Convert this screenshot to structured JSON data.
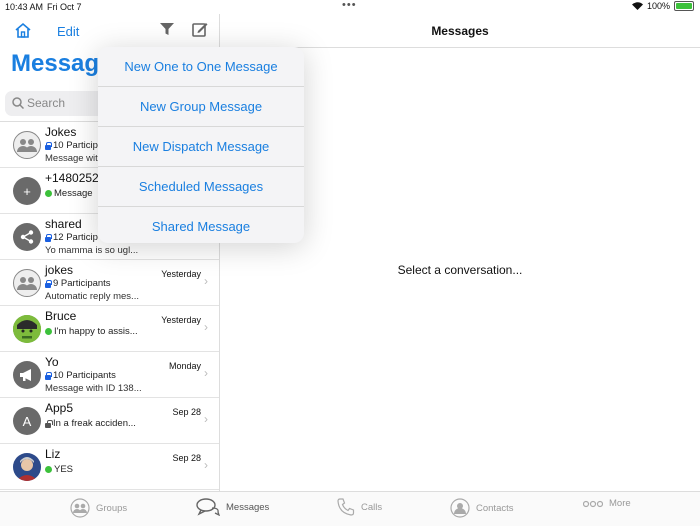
{
  "status": {
    "time": "10:43 AM",
    "date": "Fri Oct 7",
    "battery": "100%"
  },
  "sidebar": {
    "edit_label": "Edit",
    "title": "Messages",
    "search_placeholder": "Search",
    "conversations": [
      {
        "name": "Jokes",
        "sub": "10 Particip",
        "msg": "Message wit",
        "date": "",
        "avatar": "group",
        "badge": "lock"
      },
      {
        "name": "+1480252",
        "sub": "Message",
        "msg": "",
        "date": "",
        "avatar": "plus",
        "badge": "wa"
      },
      {
        "name": "shared",
        "sub": "12 Particip",
        "msg": "Yo mamma is so ugl...",
        "date": "",
        "avatar": "share",
        "badge": "lock"
      },
      {
        "name": "jokes",
        "sub": "9 Participants",
        "msg": "Automatic reply mes...",
        "date": "Yesterday",
        "avatar": "group",
        "badge": "lock"
      },
      {
        "name": "Bruce",
        "sub": "I'm happy to assis...",
        "msg": "",
        "date": "Yesterday",
        "avatar": "hulk",
        "badge": "wa"
      },
      {
        "name": "Yo",
        "sub": "10 Participants",
        "msg": "Message with ID 138...",
        "date": "Monday",
        "avatar": "megaphone",
        "badge": "lock"
      },
      {
        "name": "App5",
        "sub": "In a freak acciden...",
        "msg": "",
        "date": "Sep 28",
        "avatar": "A",
        "badge": "lock-open"
      },
      {
        "name": "Liz",
        "sub": "YES",
        "msg": "",
        "date": "Sep 28",
        "avatar": "photo",
        "badge": "wa"
      }
    ]
  },
  "popup": {
    "items": [
      "New One to One Message",
      "New Group Message",
      "New Dispatch Message",
      "Scheduled Messages",
      "Shared Message"
    ]
  },
  "detail": {
    "title": "Messages",
    "placeholder": "Select a conversation..."
  },
  "tabs": [
    {
      "label": "Groups",
      "icon": "groups-icon"
    },
    {
      "label": "Messages",
      "icon": "messages-icon"
    },
    {
      "label": "Calls",
      "icon": "phone-icon"
    },
    {
      "label": "Contacts",
      "icon": "contacts-icon"
    },
    {
      "label": "More",
      "icon": "more-icon"
    }
  ],
  "colors": {
    "accent": "#1a7fe0",
    "whatsapp": "#3cc13b",
    "battery": "#3cc13b"
  }
}
